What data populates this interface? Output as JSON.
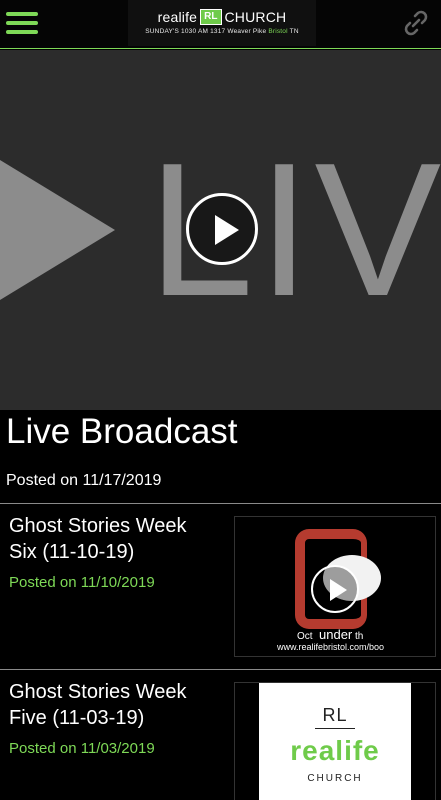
{
  "header": {
    "logo_left": "realife",
    "logo_badge": "RL",
    "logo_right": "CHURCH",
    "logo_sub_main": "SUNDAY'S 1030 AM 1317 Weaver Pike",
    "logo_sub_city": "Bristol",
    "logo_sub_state": "TN",
    "menu_icon": "hamburger-icon",
    "link_icon": "chain-link-icon",
    "accent_color": "#7ed957"
  },
  "hero": {
    "graphic_text": "LIVE",
    "play_icon": "play-icon"
  },
  "featured": {
    "title": "Live Broadcast",
    "date": "Posted on 11/17/2019"
  },
  "items": [
    {
      "title": "Ghost Stories Week Six (11-10-19)",
      "date": "Posted on 11/10/2019",
      "thumb_caption_a": "Oct",
      "thumb_caption_b": "under",
      "thumb_caption_c": "th",
      "thumb_url": "www.realifebristol.com/boo"
    },
    {
      "title": "Ghost Stories Week Five (11-03-19)",
      "date": "Posted on 11/03/2019",
      "thumb_rl": "RL",
      "thumb_word": "realife",
      "thumb_church": "CHURCH"
    }
  ]
}
